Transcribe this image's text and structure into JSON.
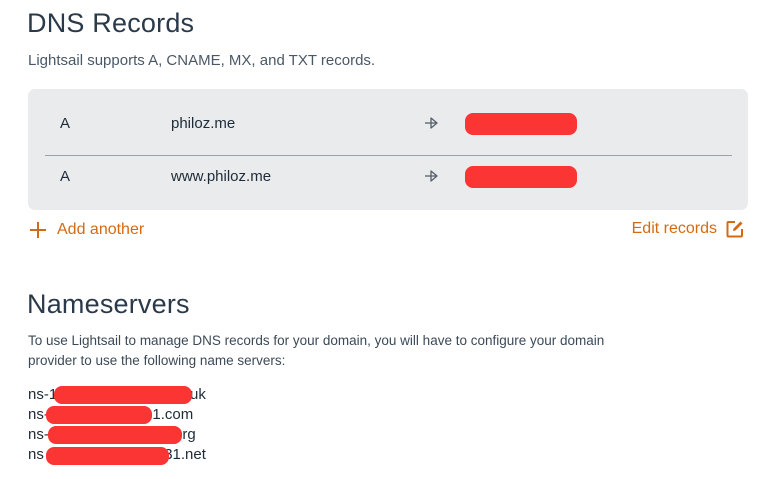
{
  "dns": {
    "title": "DNS Records",
    "subtitle": "Lightsail supports A, CNAME, MX, and TXT records.",
    "records": [
      {
        "type": "A",
        "name": "philoz.me"
      },
      {
        "type": "A",
        "name": "www.philoz.me"
      }
    ],
    "add_another_label": "Add another",
    "edit_records_label": "Edit records"
  },
  "nameservers": {
    "title": "Nameservers",
    "description": "To use Lightsail to manage DNS records for your domain, you will have to configure your domain provider to use the following name servers:",
    "items": [
      {
        "prefix": "ns-1",
        "suffix": "2.co.uk"
      },
      {
        "prefix": "ns-",
        "suffix": ".1.com"
      },
      {
        "prefix": "ns-",
        "suffix": "23.org"
      },
      {
        "prefix": "ns",
        "suffix": "31.net"
      }
    ]
  },
  "colors": {
    "accent": "#d66a12",
    "panel_bg": "#e9ebed",
    "redaction": "#fb3434"
  }
}
